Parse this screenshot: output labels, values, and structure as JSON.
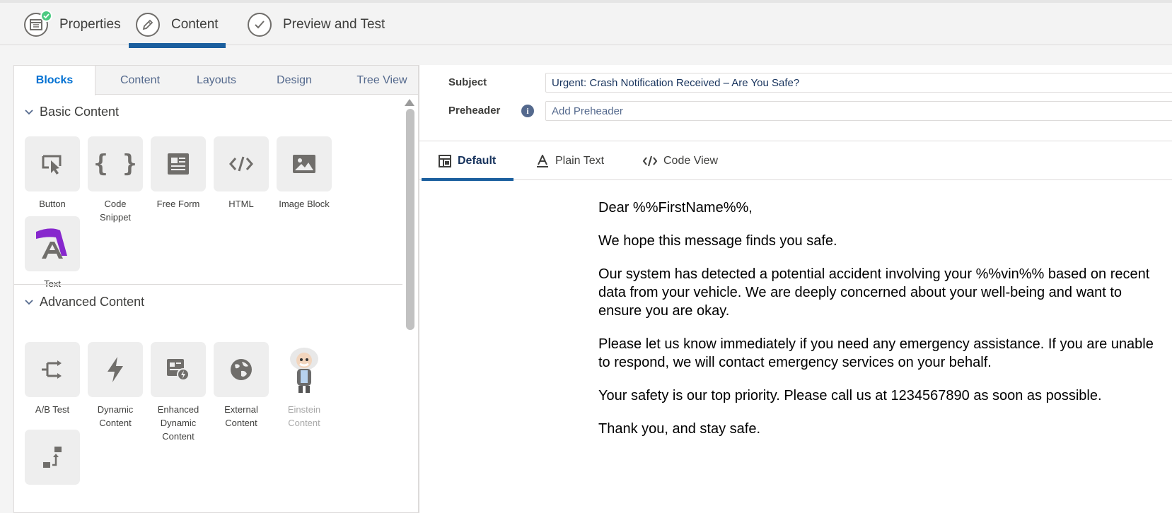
{
  "steps": [
    {
      "label": "Properties",
      "icon": "properties-icon",
      "completed": true
    },
    {
      "label": "Content",
      "icon": "pencil-icon",
      "active": true
    },
    {
      "label": "Preview and Test",
      "icon": "check-icon"
    }
  ],
  "left_tabs": [
    "Blocks",
    "Content",
    "Layouts",
    "Design",
    "Tree View"
  ],
  "basic_content": {
    "title": "Basic Content",
    "blocks": [
      "Button",
      "Code Snippet",
      "Free Form",
      "HTML",
      "Image Block",
      "Text"
    ]
  },
  "advanced_content": {
    "title": "Advanced Content",
    "blocks": [
      "A/B Test",
      "Dynamic\nContent",
      "Enhanced\nDynamic\nContent",
      "External\nContent",
      "Einstein\nContent"
    ]
  },
  "subject": {
    "label": "Subject",
    "value": "Urgent: Crash Notification Received – Are You Safe?"
  },
  "preheader": {
    "label": "Preheader",
    "placeholder": "Add Preheader",
    "info": "i"
  },
  "view_tabs": [
    "Default",
    "Plain Text",
    "Code View"
  ],
  "email": {
    "greeting": "Dear %%FirstName%%,",
    "p1": "We hope this message finds you safe.",
    "p2": "Our system has detected a potential accident involving your %%vin%% based on recent data from your vehicle. We are deeply concerned about your well-being and want to ensure you are okay.",
    "p3": "Please let us know immediately if you need any emergency assistance. If you are unable to respond, we will contact emergency services on your behalf.",
    "p4": "Your safety is our top priority. Please call us at 1234567890 as soon as possible.",
    "p5": "Thank you, and stay safe."
  },
  "colors": {
    "accent": "#1b5f9e",
    "tab_active": "#0070d2",
    "check_badge": "#4bca81",
    "text_block_icon": "#7b12c9"
  }
}
